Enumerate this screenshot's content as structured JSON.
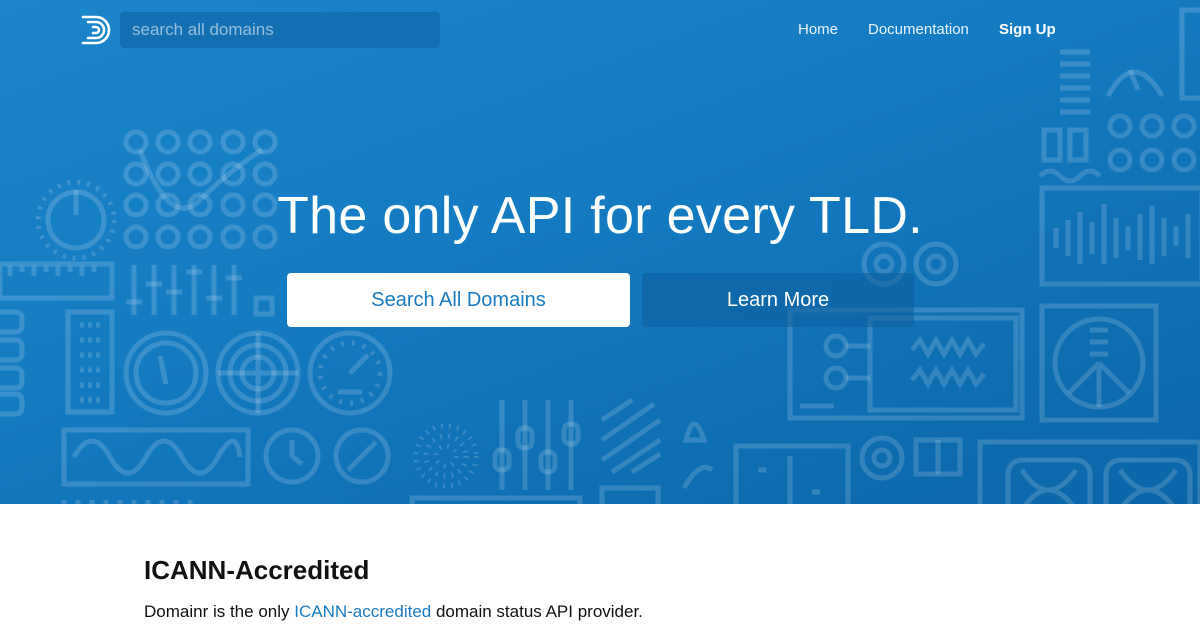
{
  "header": {
    "search_placeholder": "search all domains",
    "nav": {
      "home": "Home",
      "documentation": "Documentation",
      "signup": "Sign Up"
    }
  },
  "hero": {
    "headline": "The only API for every TLD.",
    "primary_button": "Search All Domains",
    "secondary_button": "Learn More"
  },
  "section": {
    "title": "ICANN-Accredited",
    "text_before": "Domainr is the only ",
    "link_text": "ICANN-accredited",
    "text_after": " domain status API provider."
  },
  "colors": {
    "hero_blue": "#137bc2",
    "link_blue": "#1a7bc0",
    "button_text": "#1a7bc0"
  },
  "icons": [
    "domainr-logo-icon",
    "dial-icon",
    "knob-icon",
    "slider-icon",
    "gauge-icon",
    "radar-icon",
    "clock-icon",
    "waveform-icon",
    "equalizer-icon"
  ]
}
